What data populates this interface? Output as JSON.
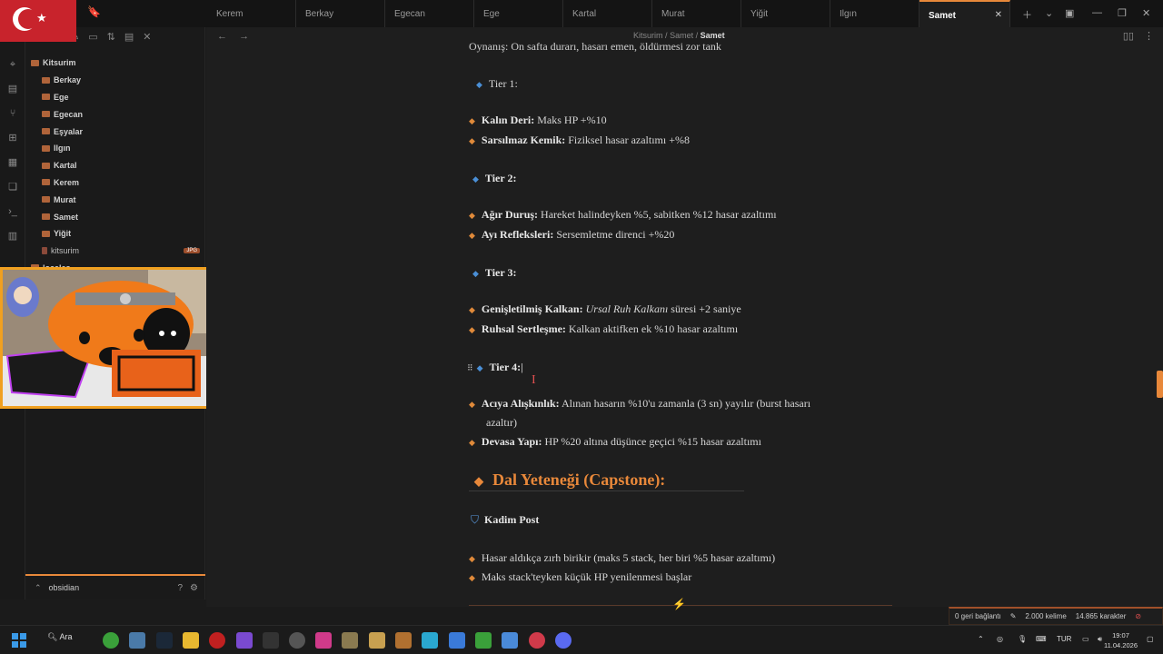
{
  "tabs": [
    {
      "label": "Kerem"
    },
    {
      "label": "Berkay"
    },
    {
      "label": "Egecan"
    },
    {
      "label": "Ege"
    },
    {
      "label": "Kartal"
    },
    {
      "label": "Murat"
    },
    {
      "label": "Yiğit"
    },
    {
      "label": "Ilgın"
    },
    {
      "label": "Samet",
      "active": true
    }
  ],
  "breadcrumb": {
    "root": "Kitsurim",
    "sep1": "/",
    "parent": "Samet",
    "sep2": "/",
    "current": "Samet"
  },
  "tree": {
    "root": "Kitsurim",
    "folders": [
      "Berkay",
      "Ege",
      "Egecan",
      "Eşyalar",
      "Ilgın",
      "Kartal",
      "Kerem",
      "Murat",
      "Samet",
      "Yiğit"
    ],
    "file": "kitsurim",
    "file_badge": "JPG",
    "locales": "locales"
  },
  "vault": {
    "name": "obsidian"
  },
  "content": {
    "top_cut": "Oynanış: On safta durarı, hasarı emen, öldürmesi zor tank",
    "tier1": "Tier 1:",
    "t1a_label": "Kalın Deri:",
    "t1a_text": "Maks HP +%10",
    "t1b_label": "Sarsılmaz Kemik:",
    "t1b_text": "Fiziksel hasar azaltımı +%8",
    "tier2": "Tier 2:",
    "t2a_label": "Ağır Duruş:",
    "t2a_text": "Hareket halindeyken %5, sabitken %12 hasar azaltımı",
    "t2b_label": "Ayı Refleksleri:",
    "t2b_text": "Sersemletme direnci +%20",
    "tier3": "Tier 3:",
    "t3a_label": "Genişletilmiş Kalkan:",
    "t3a_italic": "Ursal Ruh Kalkanı",
    "t3a_text": "süresi +2 saniye",
    "t3b_label": "Ruhsal Sertleşme:",
    "t3b_text": "Kalkan aktifken ek %10 hasar azaltımı",
    "tier4": "Tier 4:",
    "t4a_label": "Acıya Alışkınlık:",
    "t4a_text": "Alınan hasarın %10'u zamanla (3 sn) yayılır (burst hasarı",
    "t4a_text2": "azaltır)",
    "t4b_label": "Devasa Yapı:",
    "t4b_text": "HP %20 altına düşünce geçici %15 hasar azaltımı",
    "capstone": "Dal Yeteneği (Capstone):",
    "capstone_skill": "Kadim Post",
    "cap_a": "Hasar aldıkça zırh birikir (maks 5 stack, her biri %5 hasar azaltımı)",
    "cap_b": "Maks stack'teyken küçük HP yenilenmesi başlar"
  },
  "status": {
    "backlinks": "0 geri bağlantı",
    "words": "2.000 kelime",
    "chars": "14.865 karakter"
  },
  "taskbar": {
    "search": "Ara",
    "lang": "TUR",
    "time": "19:07",
    "date": "11.04.2026"
  },
  "colors": {
    "accent": "#e8883a",
    "bullet_blue": "#4a8fd6",
    "flag_red": "#c8232c"
  }
}
